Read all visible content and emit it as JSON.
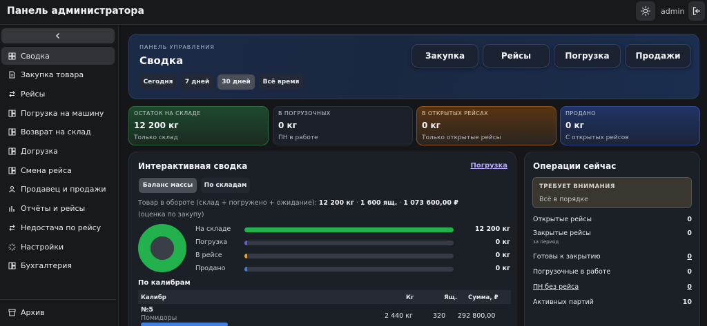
{
  "header": {
    "title": "Панель администратора",
    "user": "admin",
    "theme_icon": "sun-icon",
    "logout_icon": "logout-icon"
  },
  "sidebar": {
    "collapse_icon": "chevron-left-icon",
    "items": [
      {
        "label": "Сводка",
        "icon": "dashboard-icon",
        "active": true
      },
      {
        "label": "Закупка товара",
        "icon": "document-icon"
      },
      {
        "label": "Рейсы",
        "icon": "swap-icon"
      },
      {
        "label": "Погрузка на машину",
        "icon": "grid-icon"
      },
      {
        "label": "Возврат на склад",
        "icon": "grid-icon"
      },
      {
        "label": "Догрузка",
        "icon": "grid-icon"
      },
      {
        "label": "Смена рейса",
        "icon": "grid-icon"
      },
      {
        "label": "Продавец и продажи",
        "icon": "user-icon"
      },
      {
        "label": "Отчёты и рейсы",
        "icon": "chart-icon"
      },
      {
        "label": "Недостача по рейсу",
        "icon": "swap-icon"
      },
      {
        "label": "Настройки",
        "icon": "settings-icon"
      },
      {
        "label": "Бухгалтерия",
        "icon": "grid-icon"
      }
    ],
    "archive": {
      "label": "Архив",
      "icon": "archive-icon"
    }
  },
  "hero": {
    "kicker": "ПАНЕЛЬ УПРАВЛЕНИЯ",
    "title": "Сводка",
    "periods": [
      "Сегодня",
      "7 дней",
      "30 дней",
      "Всё время"
    ],
    "active_period": "30 дней",
    "actions": [
      "Закупка",
      "Рейсы",
      "Погрузка",
      "Продажи"
    ]
  },
  "stats": [
    {
      "label": "ОСТАТОК НА СКЛАДЕ",
      "value": "12 200 кг",
      "note": "Только склад",
      "tone": "green"
    },
    {
      "label": "В ПОГРУЗОЧНЫХ",
      "value": "0 кг",
      "note": "ПН в работе",
      "tone": "neutral"
    },
    {
      "label": "В ОТКРЫТЫХ РЕЙСАХ",
      "value": "0 кг",
      "note": "Только открытые рейсы",
      "tone": "orange"
    },
    {
      "label": "ПРОДАНО",
      "value": "0 кг",
      "note": "С открытых рейсов",
      "tone": "blue"
    }
  ],
  "summary": {
    "title": "Интерактивная сводка",
    "link": "Погрузка",
    "tabs": [
      "Баланс массы",
      "По складам"
    ],
    "active_tab": "Баланс массы",
    "turnover_label": "Товар в обороте (склад + погружено + ожидание):",
    "turnover_kg": "12 200 кг",
    "turnover_boxes": "1 600 ящ.",
    "turnover_sum": "1 073 600,00 ₽",
    "turnover_note": "(оценка по закупу)",
    "balance": [
      {
        "label": "На складе",
        "value": "12 200 кг",
        "fraction": 1.0,
        "color": "#22b14c"
      },
      {
        "label": "Погрузка",
        "value": "0 кг",
        "fraction": 0.0,
        "color": "#6b5bd6"
      },
      {
        "label": "В рейсе",
        "value": "0 кг",
        "fraction": 0.0,
        "color": "#f0a020"
      },
      {
        "label": "Продано",
        "value": "0 кг",
        "fraction": 0.0,
        "color": "#3f7fe0"
      }
    ],
    "calibers_title": "По калибрам",
    "table": {
      "headers": [
        "Калибр",
        "Кг",
        "Ящ.",
        "Сумма, ₽"
      ],
      "rows": [
        {
          "name": "№5",
          "sub": "Помидоры",
          "kg": "2 440 кг",
          "boxes": "320",
          "sum": "292 800,00",
          "share": 0.2
        }
      ]
    }
  },
  "operations": {
    "title": "Операции сейчас",
    "attention_label": "ТРЕБУЕТ ВНИМАНИЯ",
    "attention_text": "Всё в порядке",
    "rows": [
      {
        "label": "Открытые рейсы",
        "value": "0"
      },
      {
        "label": "Закрытые рейсы",
        "value": "0",
        "sub": "за период"
      },
      {
        "label": "Готовы к закрытию",
        "value": "0",
        "underline": true
      },
      {
        "label": "Погрузочные в работе",
        "value": "0"
      },
      {
        "label": "ПН без рейса",
        "value": "0",
        "underline": true
      },
      {
        "label": "Активных партий",
        "value": "10"
      }
    ]
  }
}
